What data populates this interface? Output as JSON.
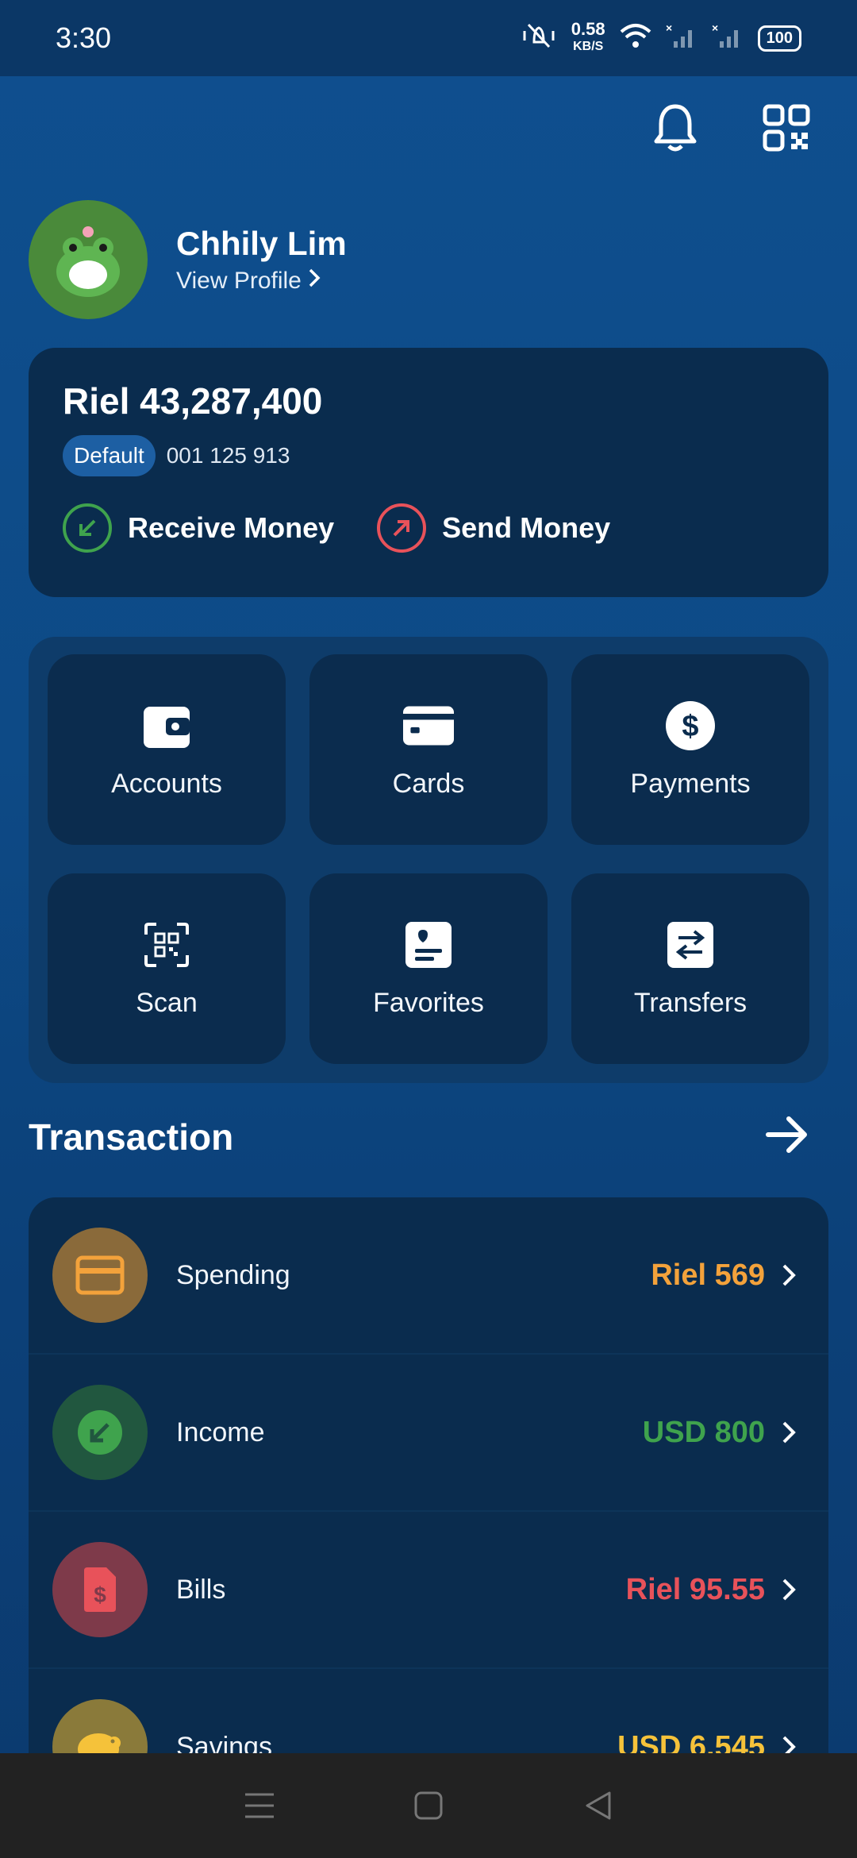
{
  "status_bar": {
    "time": "3:30",
    "speed_value": "0.58",
    "speed_unit": "KB/S",
    "battery": "100"
  },
  "header": {
    "icons": [
      "bell-icon",
      "qr-code-icon"
    ]
  },
  "profile": {
    "name": "Chhily Lim",
    "link": "View Profile"
  },
  "balance": {
    "amount": "Riel 43,287,400",
    "badge": "Default",
    "account_number": "001 125 913",
    "receive_label": "Receive Money",
    "send_label": "Send Money"
  },
  "menu": {
    "tiles": [
      {
        "label": "Accounts",
        "icon": "wallet-icon"
      },
      {
        "label": "Cards",
        "icon": "card-icon"
      },
      {
        "label": "Payments",
        "icon": "dollar-icon"
      },
      {
        "label": "Scan",
        "icon": "scan-icon"
      },
      {
        "label": "Favorites",
        "icon": "favorites-icon"
      },
      {
        "label": "Transfers",
        "icon": "transfer-icon"
      }
    ]
  },
  "transactions": {
    "title": "Transaction",
    "items": [
      {
        "label": "Spending",
        "amount": "Riel 569",
        "color": "#f3a23b",
        "bg": "#8a6a3a"
      },
      {
        "label": "Income",
        "amount": "USD 800",
        "color": "#3fa34d",
        "bg": "#21573f"
      },
      {
        "label": "Bills",
        "amount": "Riel 95.55",
        "color": "#e8525a",
        "bg": "#7e3a4a"
      },
      {
        "label": "Savings",
        "amount": "USD 6,545",
        "color": "#f5c23a",
        "bg": "#8a7a3a"
      }
    ]
  },
  "colors": {
    "accent_blue": "#1d5fa3",
    "card_bg": "#0a2c4e",
    "receive": "#3fa34d",
    "send": "#e8525a"
  }
}
